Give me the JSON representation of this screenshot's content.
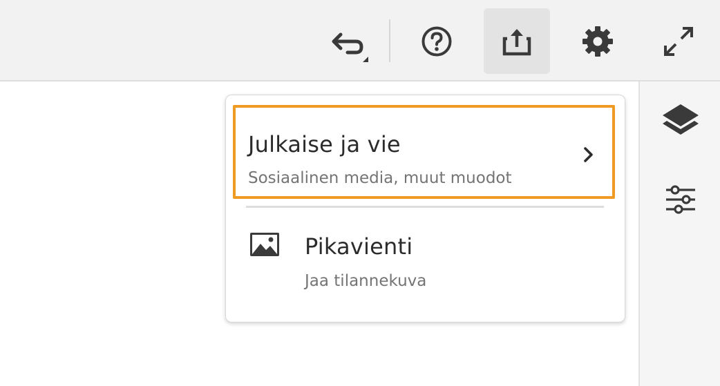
{
  "toolbar": {
    "icons": [
      {
        "name": "undo-icon"
      },
      {
        "name": "help-icon"
      },
      {
        "name": "share-icon"
      },
      {
        "name": "gear-icon"
      },
      {
        "name": "expand-icon"
      }
    ],
    "active": "share-icon"
  },
  "right_rail": {
    "icons": [
      {
        "name": "layers-icon"
      },
      {
        "name": "adjustments-icon"
      }
    ]
  },
  "popover": {
    "items": [
      {
        "title": "Julkaise ja vie",
        "subtitle": "Sosiaalinen media, muut muodot",
        "icon": "chevron-right-icon",
        "highlight_color": "#ef9a22"
      },
      {
        "title": "Pikavienti",
        "subtitle": "Jaa tilannekuva",
        "icon": "image-icon"
      }
    ]
  },
  "colors": {
    "toolbar_bg": "#f2f2f2",
    "icon": "#3a3a3a",
    "highlight": "#ef9a22",
    "subtitle": "#747474"
  }
}
